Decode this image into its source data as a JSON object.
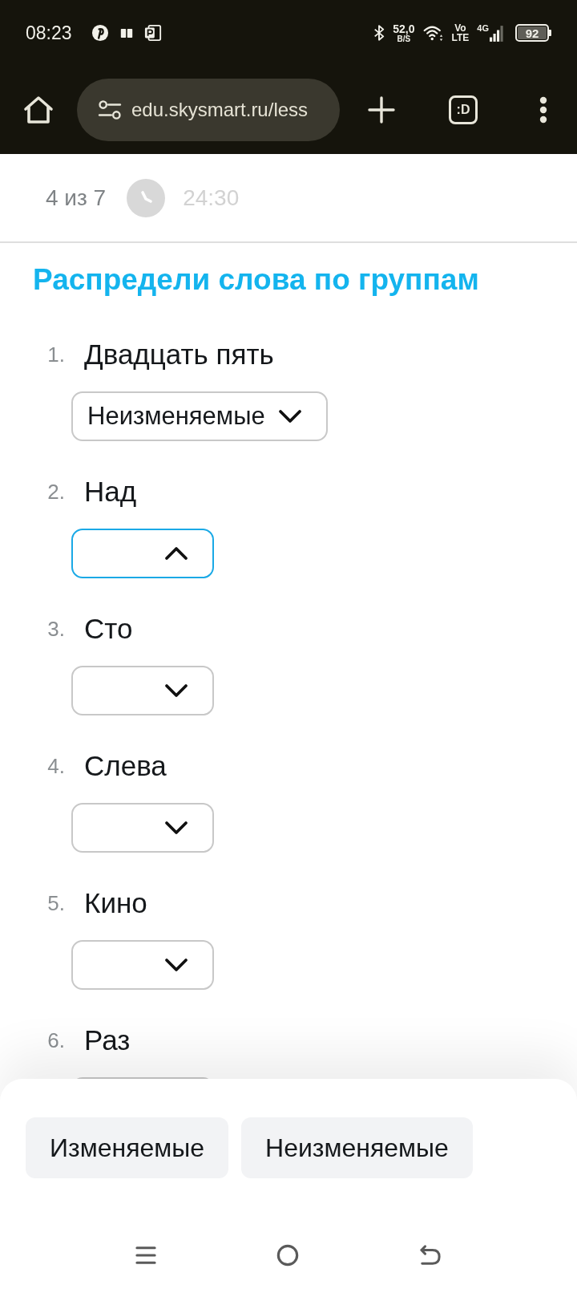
{
  "status_bar": {
    "time": "08:23",
    "net_speed": "52,0",
    "net_speed_unit": "B/S",
    "volte_lines": [
      "Vo",
      "LTE"
    ],
    "network": "4G",
    "battery": "92"
  },
  "browser_toolbar": {
    "url": "edu.skysmart.ru/less",
    "tabs_button": ":D"
  },
  "header": {
    "question_counter": "4 из 7",
    "timer": "24:30"
  },
  "task": {
    "title": "Распредели слова по группам",
    "items": [
      {
        "number": "1.",
        "word": "Двадцать пять",
        "answer": "Неизменяемые",
        "expanded": false
      },
      {
        "number": "2.",
        "word": "Над",
        "expanded": true
      },
      {
        "number": "3.",
        "word": "Сто",
        "expanded": false
      },
      {
        "number": "4.",
        "word": "Слева",
        "expanded": false
      },
      {
        "number": "5.",
        "word": "Кино",
        "expanded": false
      },
      {
        "number": "6.",
        "word": "Раз"
      }
    ]
  },
  "options": [
    {
      "label": "Изменяемые"
    },
    {
      "label": "Неизменяемые"
    }
  ]
}
